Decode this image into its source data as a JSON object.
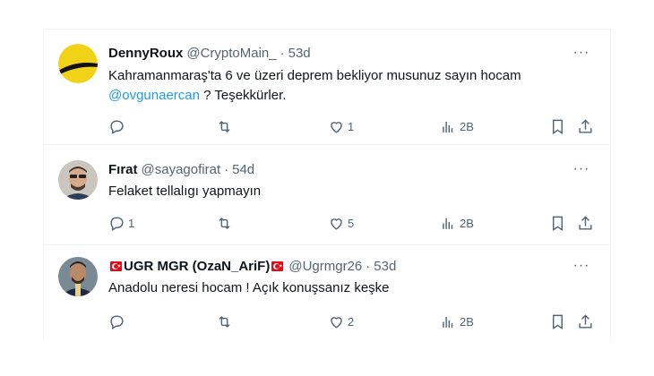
{
  "tweets": [
    {
      "name": "DennyRoux",
      "handle": "@CryptoMain_",
      "dot": "·",
      "time": "53d",
      "text_line1": "Kahramanmaraş'ta 6 ve üzeri deprem bekliyor musunuz sayın hocam",
      "mention": "@ovgunaercan",
      "text_line2_rest": " ? Teşekkürler.",
      "reply_count": "",
      "retweet_count": "",
      "like_count": "1",
      "views": "2B",
      "avatar_icon": "yellow-black-circle-avatar"
    },
    {
      "name": "Fırat",
      "handle": "@sayagofirat",
      "dot": "·",
      "time": "54d",
      "text_line1": "Felaket tellalıgı yapmayın",
      "reply_count": "1",
      "retweet_count": "",
      "like_count": "5",
      "views": "2B",
      "avatar_icon": "person-photo-avatar"
    },
    {
      "name": "UGR MGR (OzaN_AriF)",
      "handle": "@Ugrmgr26",
      "dot": "·",
      "time": "53d",
      "text_line1": "Anadolu neresi hocam ! Açık konuşsanız keşke",
      "reply_count": "",
      "retweet_count": "",
      "like_count": "2",
      "views": "2B",
      "avatar_icon": "person-photo-avatar",
      "name_flags": "turkey-flag"
    }
  ],
  "more_label": "···",
  "colors": {
    "link": "#1d9bf0",
    "secondary": "#536471",
    "text": "#0f1419",
    "border": "#eff3f4"
  }
}
